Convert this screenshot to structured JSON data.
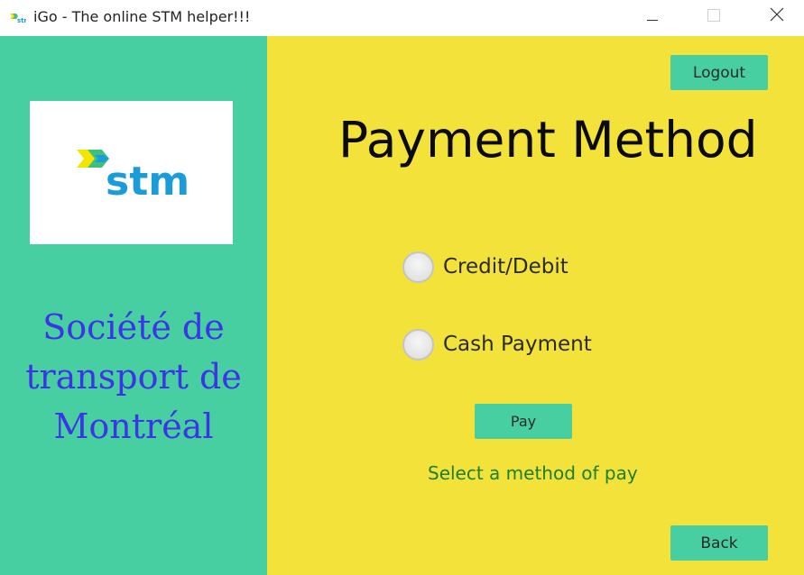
{
  "window": {
    "title": "iGo - The online STM helper!!!",
    "app_icon": "stm-logo-icon",
    "controls": [
      "minimize-icon",
      "maximize-icon",
      "close-icon"
    ]
  },
  "sidebar": {
    "logo_text": "stm",
    "org_name_lines": [
      "Société de",
      "transport de",
      "Montréal"
    ]
  },
  "main": {
    "logout_label": "Logout",
    "title": "Payment Method",
    "options": [
      {
        "label": "Credit/Debit",
        "selected": false
      },
      {
        "label": "Cash Payment",
        "selected": false
      }
    ],
    "pay_label": "Pay",
    "status_message": "Select a method of pay",
    "back_label": "Back"
  },
  "colors": {
    "sidebar_bg": "#48cfa1",
    "main_bg": "#f2e23a",
    "button_bg": "#48cfa1",
    "org_text": "#3b35e6",
    "status_text": "#1e7f26",
    "logo_blue": "#1a9cd8",
    "logo_yellow": "#f5e400",
    "logo_green": "#3ec17a"
  }
}
